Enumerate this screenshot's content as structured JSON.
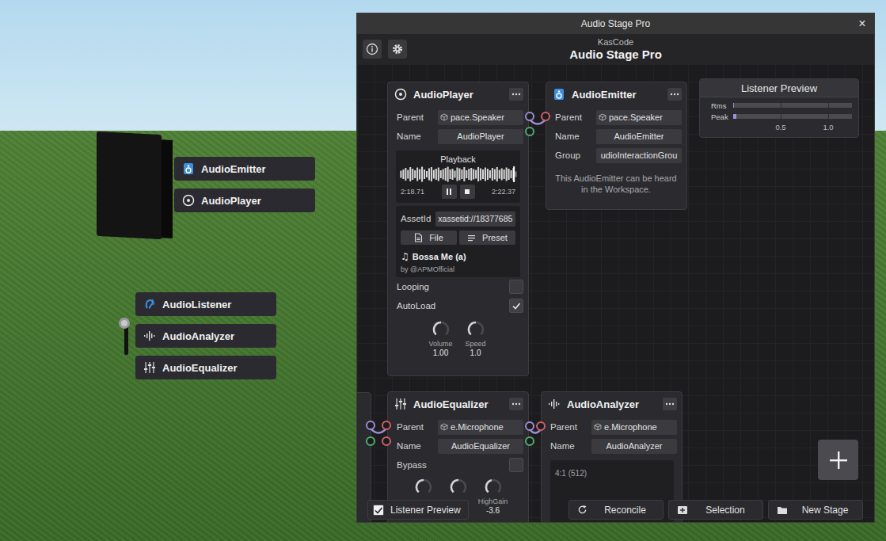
{
  "window": {
    "title": "Audio Stage Pro",
    "close": "×",
    "author": "KasCode",
    "heading": "Audio Stage Pro"
  },
  "scene": {
    "speaker_tags": [
      {
        "label": "AudioEmitter",
        "kind": "emitter"
      },
      {
        "label": "AudioPlayer",
        "kind": "player"
      }
    ],
    "microphone_tags": [
      {
        "label": "AudioListener",
        "kind": "listener"
      },
      {
        "label": "AudioAnalyzer",
        "kind": "analyzer"
      },
      {
        "label": "AudioEqualizer",
        "kind": "equalizer"
      }
    ]
  },
  "player": {
    "title": "AudioPlayer",
    "props": [
      {
        "label": "Parent",
        "value": "pace.Speaker",
        "kind": "instance"
      },
      {
        "label": "Name",
        "value": "AudioPlayer",
        "kind": "text"
      }
    ],
    "playback": {
      "title": "Playback",
      "position": "2:18.71",
      "length": "2:22.37",
      "playing": true,
      "level": 0.974,
      "waveform": [
        0.45,
        0.6,
        0.8,
        0.55,
        0.9,
        0.7,
        0.5,
        0.85,
        0.65,
        0.95,
        0.6,
        0.4,
        0.75,
        0.9,
        0.55,
        0.7,
        0.85,
        0.5,
        0.65,
        0.8,
        0.95,
        0.6,
        0.7,
        0.45,
        0.85,
        0.75,
        0.6,
        0.9,
        0.5,
        0.7,
        0.8,
        0.65,
        0.55,
        0.9,
        0.75,
        0.6,
        0.85,
        0.7,
        0.5,
        0.8,
        0.65,
        0.9,
        0.55,
        0.75,
        0.6,
        0.85,
        0.7,
        0.5,
        0.8,
        0.35
      ]
    },
    "asset": {
      "label": "AssetId",
      "value": "xassetid://18377685",
      "buttons": [
        {
          "label": "File",
          "kind": "file"
        },
        {
          "label": "Preset",
          "kind": "preset"
        }
      ],
      "track_icon": "♫",
      "track": "Bossa Me (a)",
      "artist": "by @APMOfficial"
    },
    "toggles": [
      {
        "label": "Looping",
        "checked": false
      },
      {
        "label": "AutoLoad",
        "checked": true
      }
    ],
    "knobs": [
      {
        "label": "Volume",
        "value": "1.00",
        "level": 0.5
      },
      {
        "label": "Speed",
        "value": "1.0",
        "level": 0.5
      }
    ]
  },
  "emitter": {
    "title": "AudioEmitter",
    "props": [
      {
        "label": "Parent",
        "value": "pace.Speaker",
        "kind": "instance"
      },
      {
        "label": "Name",
        "value": "AudioEmitter",
        "kind": "text"
      },
      {
        "label": "Group",
        "value": "udioInteractionGrou",
        "kind": "text"
      }
    ],
    "note": "This AudioEmitter can be heard in the Workspace."
  },
  "listener_preview": {
    "title": "Listener Preview",
    "meters": [
      {
        "label": "Rms",
        "level": 0.01
      },
      {
        "label": "Peak",
        "level": 0.03
      }
    ],
    "ticks": [
      "0.5",
      "1.0"
    ]
  },
  "equalizer": {
    "title": "AudioEqualizer",
    "props": [
      {
        "label": "Parent",
        "value": "e.Microphone",
        "kind": "instance"
      },
      {
        "label": "Name",
        "value": "AudioEqualizer",
        "kind": "text"
      }
    ],
    "toggles": [
      {
        "label": "Bypass",
        "checked": false
      }
    ],
    "knobs": [
      {
        "level": 0.5
      },
      {
        "level": 0.5
      },
      {
        "level": 0.45,
        "label": "HighGain",
        "value": "-3.6"
      }
    ]
  },
  "analyzer": {
    "title": "AudioAnalyzer",
    "props": [
      {
        "label": "Parent",
        "value": "e.Microphone",
        "kind": "instance"
      },
      {
        "label": "Name",
        "value": "AudioAnalyzer",
        "kind": "text"
      }
    ],
    "spectrum_label": "4:1 (512)"
  },
  "bottom_bar": {
    "preview_toggle": {
      "label": "Listener Preview",
      "checked": true
    },
    "actions": [
      {
        "label": "Reconcile",
        "kind": "reconcile"
      },
      {
        "label": "Selection",
        "kind": "selection"
      },
      {
        "label": "New Stage",
        "kind": "folder"
      }
    ]
  }
}
